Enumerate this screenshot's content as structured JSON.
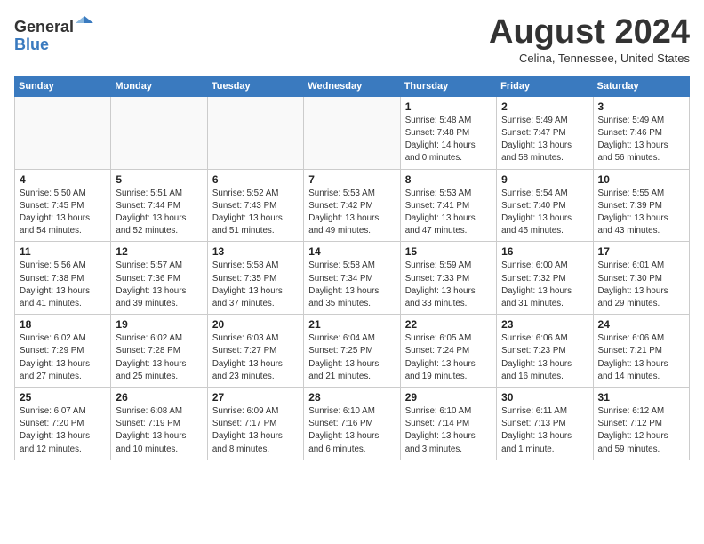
{
  "header": {
    "logo_line1": "General",
    "logo_line2": "Blue",
    "month_title": "August 2024",
    "location": "Celina, Tennessee, United States"
  },
  "weekdays": [
    "Sunday",
    "Monday",
    "Tuesday",
    "Wednesday",
    "Thursday",
    "Friday",
    "Saturday"
  ],
  "weeks": [
    [
      {
        "day": "",
        "info": ""
      },
      {
        "day": "",
        "info": ""
      },
      {
        "day": "",
        "info": ""
      },
      {
        "day": "",
        "info": ""
      },
      {
        "day": "1",
        "info": "Sunrise: 5:48 AM\nSunset: 7:48 PM\nDaylight: 14 hours\nand 0 minutes."
      },
      {
        "day": "2",
        "info": "Sunrise: 5:49 AM\nSunset: 7:47 PM\nDaylight: 13 hours\nand 58 minutes."
      },
      {
        "day": "3",
        "info": "Sunrise: 5:49 AM\nSunset: 7:46 PM\nDaylight: 13 hours\nand 56 minutes."
      }
    ],
    [
      {
        "day": "4",
        "info": "Sunrise: 5:50 AM\nSunset: 7:45 PM\nDaylight: 13 hours\nand 54 minutes."
      },
      {
        "day": "5",
        "info": "Sunrise: 5:51 AM\nSunset: 7:44 PM\nDaylight: 13 hours\nand 52 minutes."
      },
      {
        "day": "6",
        "info": "Sunrise: 5:52 AM\nSunset: 7:43 PM\nDaylight: 13 hours\nand 51 minutes."
      },
      {
        "day": "7",
        "info": "Sunrise: 5:53 AM\nSunset: 7:42 PM\nDaylight: 13 hours\nand 49 minutes."
      },
      {
        "day": "8",
        "info": "Sunrise: 5:53 AM\nSunset: 7:41 PM\nDaylight: 13 hours\nand 47 minutes."
      },
      {
        "day": "9",
        "info": "Sunrise: 5:54 AM\nSunset: 7:40 PM\nDaylight: 13 hours\nand 45 minutes."
      },
      {
        "day": "10",
        "info": "Sunrise: 5:55 AM\nSunset: 7:39 PM\nDaylight: 13 hours\nand 43 minutes."
      }
    ],
    [
      {
        "day": "11",
        "info": "Sunrise: 5:56 AM\nSunset: 7:38 PM\nDaylight: 13 hours\nand 41 minutes."
      },
      {
        "day": "12",
        "info": "Sunrise: 5:57 AM\nSunset: 7:36 PM\nDaylight: 13 hours\nand 39 minutes."
      },
      {
        "day": "13",
        "info": "Sunrise: 5:58 AM\nSunset: 7:35 PM\nDaylight: 13 hours\nand 37 minutes."
      },
      {
        "day": "14",
        "info": "Sunrise: 5:58 AM\nSunset: 7:34 PM\nDaylight: 13 hours\nand 35 minutes."
      },
      {
        "day": "15",
        "info": "Sunrise: 5:59 AM\nSunset: 7:33 PM\nDaylight: 13 hours\nand 33 minutes."
      },
      {
        "day": "16",
        "info": "Sunrise: 6:00 AM\nSunset: 7:32 PM\nDaylight: 13 hours\nand 31 minutes."
      },
      {
        "day": "17",
        "info": "Sunrise: 6:01 AM\nSunset: 7:30 PM\nDaylight: 13 hours\nand 29 minutes."
      }
    ],
    [
      {
        "day": "18",
        "info": "Sunrise: 6:02 AM\nSunset: 7:29 PM\nDaylight: 13 hours\nand 27 minutes."
      },
      {
        "day": "19",
        "info": "Sunrise: 6:02 AM\nSunset: 7:28 PM\nDaylight: 13 hours\nand 25 minutes."
      },
      {
        "day": "20",
        "info": "Sunrise: 6:03 AM\nSunset: 7:27 PM\nDaylight: 13 hours\nand 23 minutes."
      },
      {
        "day": "21",
        "info": "Sunrise: 6:04 AM\nSunset: 7:25 PM\nDaylight: 13 hours\nand 21 minutes."
      },
      {
        "day": "22",
        "info": "Sunrise: 6:05 AM\nSunset: 7:24 PM\nDaylight: 13 hours\nand 19 minutes."
      },
      {
        "day": "23",
        "info": "Sunrise: 6:06 AM\nSunset: 7:23 PM\nDaylight: 13 hours\nand 16 minutes."
      },
      {
        "day": "24",
        "info": "Sunrise: 6:06 AM\nSunset: 7:21 PM\nDaylight: 13 hours\nand 14 minutes."
      }
    ],
    [
      {
        "day": "25",
        "info": "Sunrise: 6:07 AM\nSunset: 7:20 PM\nDaylight: 13 hours\nand 12 minutes."
      },
      {
        "day": "26",
        "info": "Sunrise: 6:08 AM\nSunset: 7:19 PM\nDaylight: 13 hours\nand 10 minutes."
      },
      {
        "day": "27",
        "info": "Sunrise: 6:09 AM\nSunset: 7:17 PM\nDaylight: 13 hours\nand 8 minutes."
      },
      {
        "day": "28",
        "info": "Sunrise: 6:10 AM\nSunset: 7:16 PM\nDaylight: 13 hours\nand 6 minutes."
      },
      {
        "day": "29",
        "info": "Sunrise: 6:10 AM\nSunset: 7:14 PM\nDaylight: 13 hours\nand 3 minutes."
      },
      {
        "day": "30",
        "info": "Sunrise: 6:11 AM\nSunset: 7:13 PM\nDaylight: 13 hours\nand 1 minute."
      },
      {
        "day": "31",
        "info": "Sunrise: 6:12 AM\nSunset: 7:12 PM\nDaylight: 12 hours\nand 59 minutes."
      }
    ]
  ]
}
